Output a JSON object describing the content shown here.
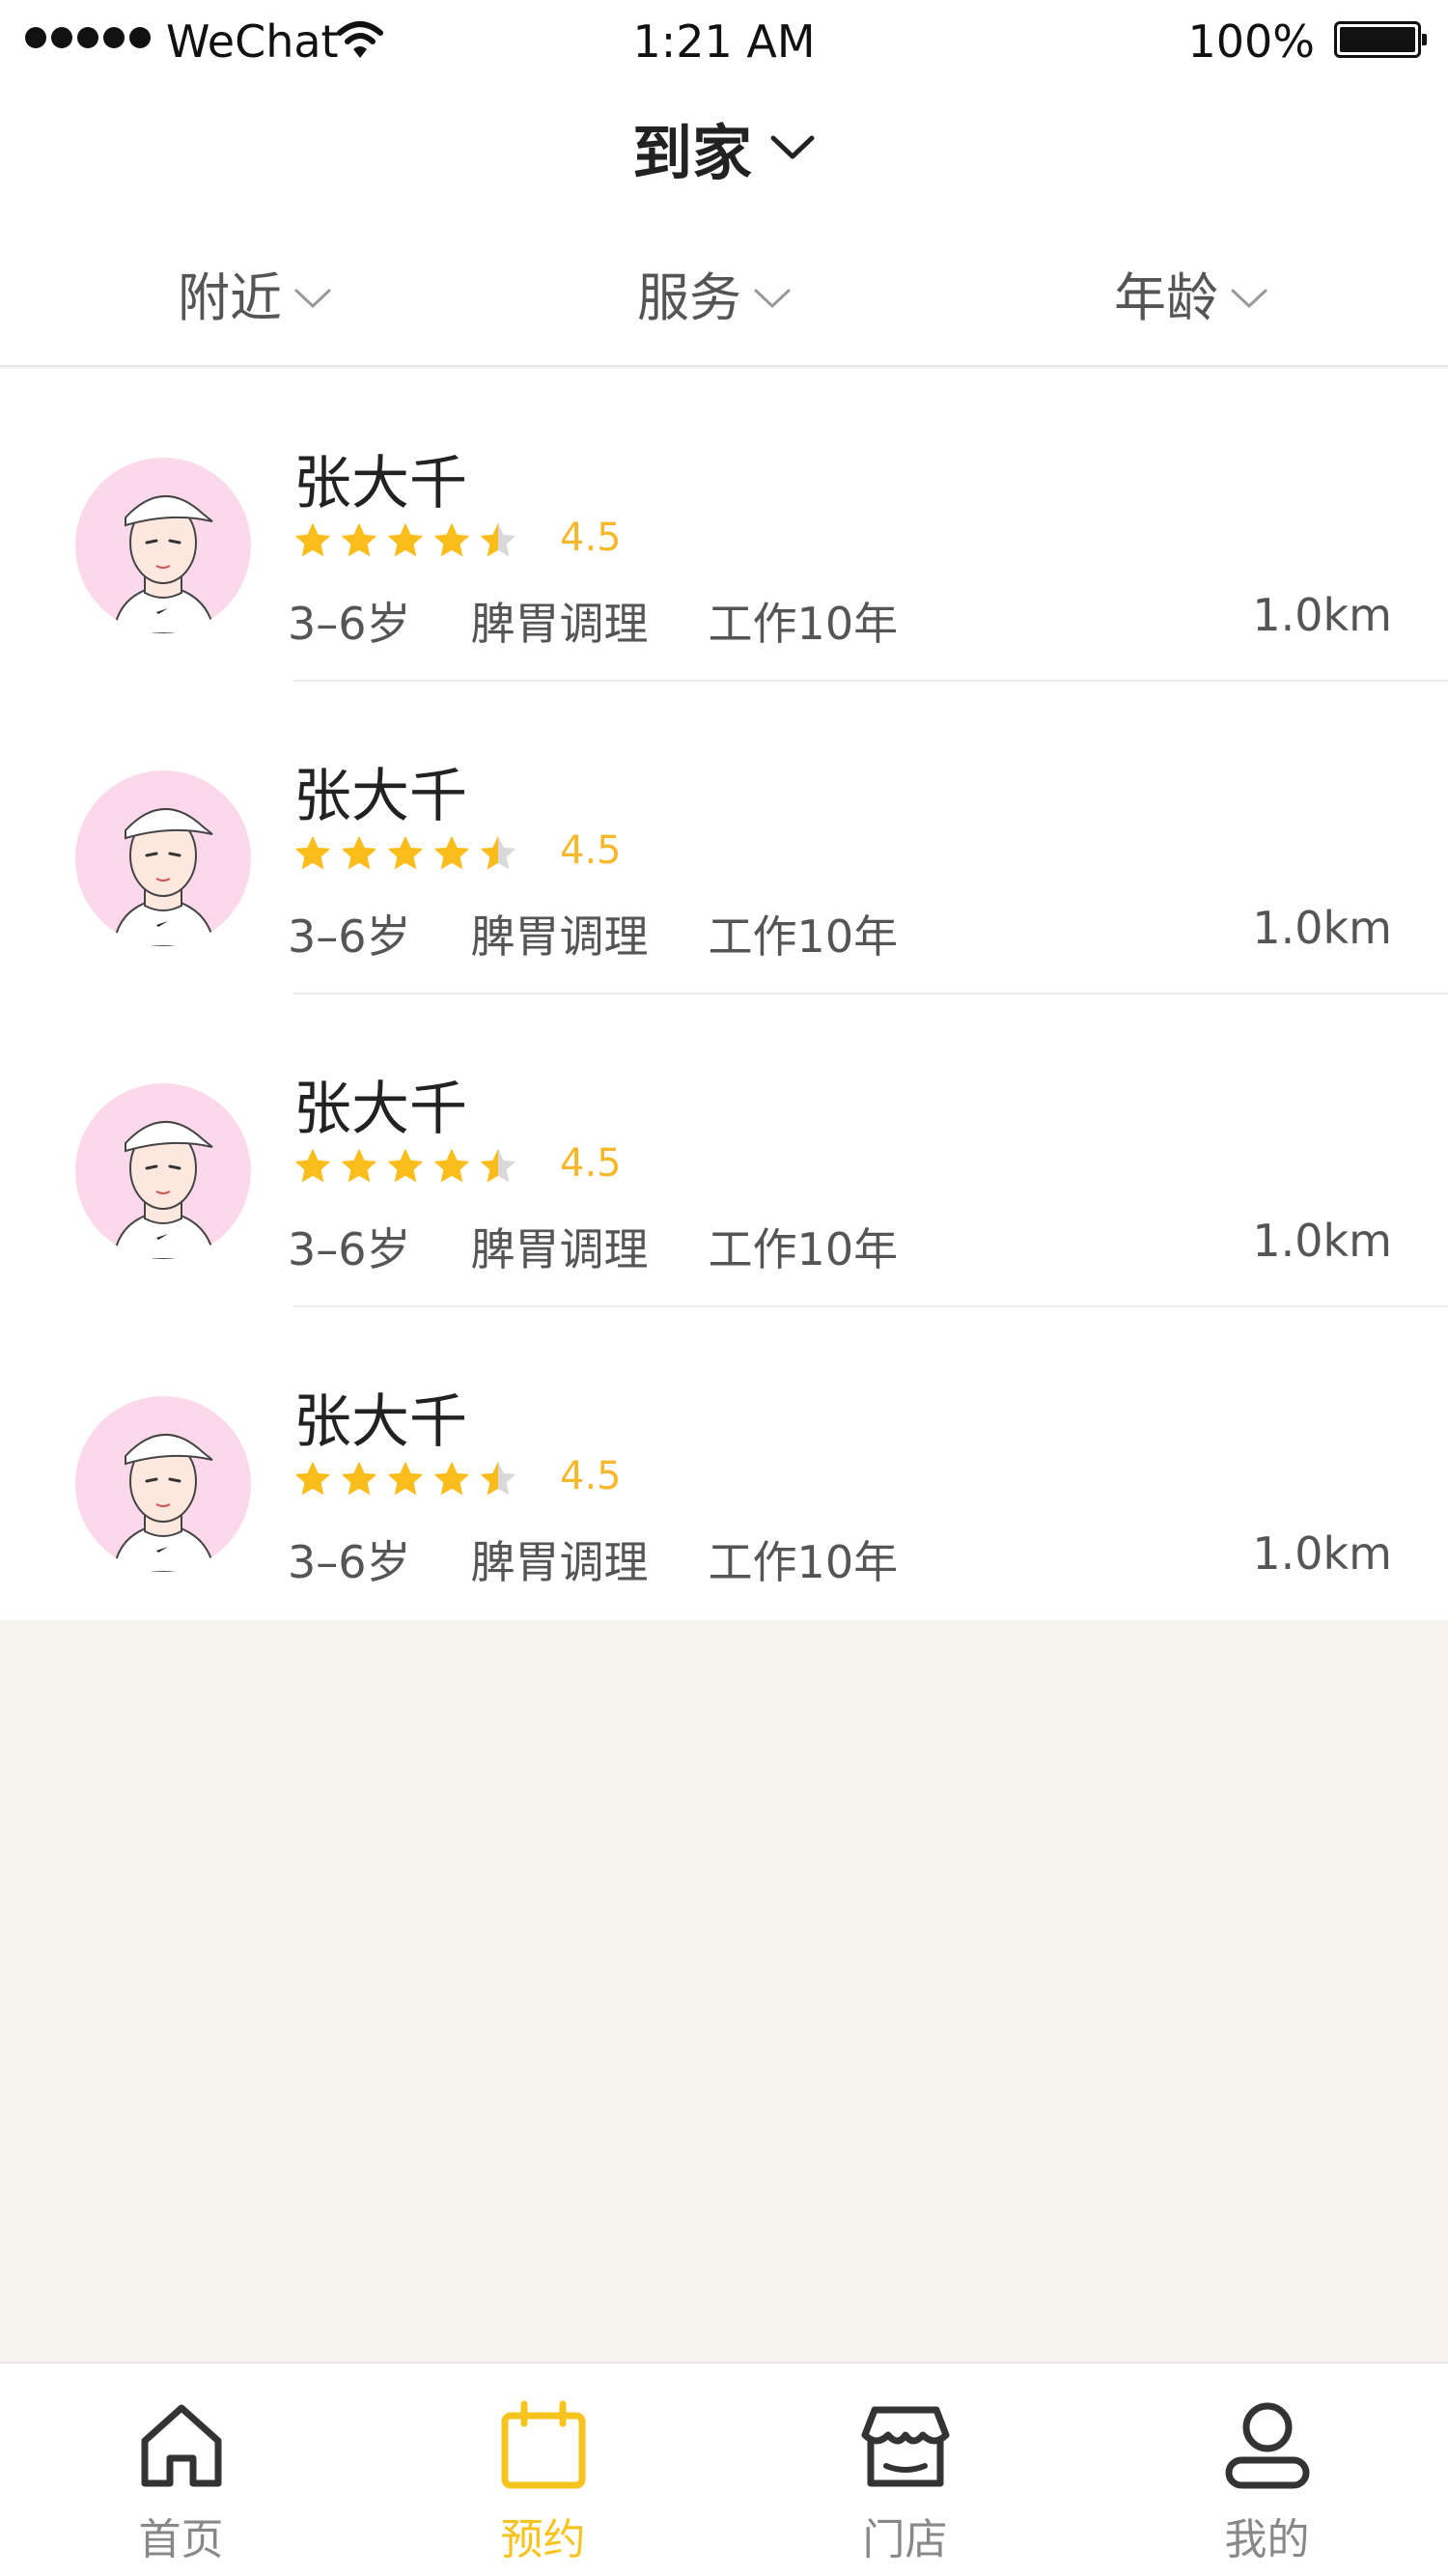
{
  "status_bar": {
    "carrier": "WeChat",
    "time": "1:21 AM",
    "battery": "100%"
  },
  "nav": {
    "title": "到家"
  },
  "filters": [
    {
      "label": "附近"
    },
    {
      "label": "服务"
    },
    {
      "label": "年龄"
    }
  ],
  "list": [
    {
      "name": "张大千",
      "rating": "4.5",
      "age": "3–6岁",
      "service": "脾胃调理",
      "experience": "工作10年",
      "distance": "1.0km"
    },
    {
      "name": "张大千",
      "rating": "4.5",
      "age": "3–6岁",
      "service": "脾胃调理",
      "experience": "工作10年",
      "distance": "1.0km"
    },
    {
      "name": "张大千",
      "rating": "4.5",
      "age": "3–6岁",
      "service": "脾胃调理",
      "experience": "工作10年",
      "distance": "1.0km"
    },
    {
      "name": "张大千",
      "rating": "4.5",
      "age": "3–6岁",
      "service": "脾胃调理",
      "experience": "工作10年",
      "distance": "1.0km"
    }
  ],
  "tabs": [
    {
      "label": "首页",
      "icon": "home-icon",
      "active": false
    },
    {
      "label": "预约",
      "icon": "calendar-icon",
      "active": true
    },
    {
      "label": "门店",
      "icon": "store-icon",
      "active": false
    },
    {
      "label": "我的",
      "icon": "user-icon",
      "active": false
    }
  ],
  "colors": {
    "accent": "#f7c31e",
    "star": "#fbbd1c",
    "star_empty": "#d9d9d9",
    "rating_text": "#f7b92b",
    "background": "#f6f3ee",
    "avatar_bg": "#fbd9ea"
  }
}
